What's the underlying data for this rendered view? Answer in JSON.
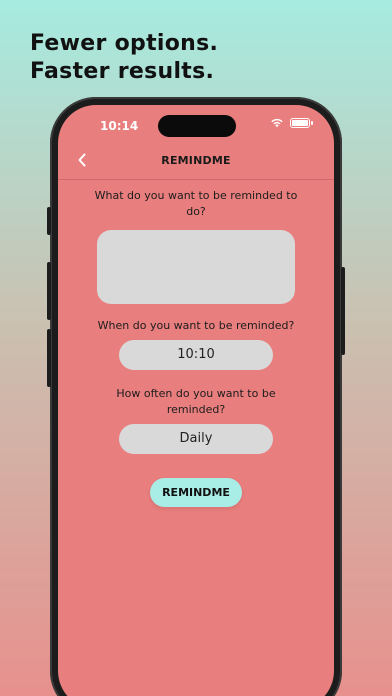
{
  "headline": {
    "line1": "Fewer options.",
    "line2": "Faster results."
  },
  "status_bar": {
    "time": "10:14",
    "icons": [
      "wifi-icon",
      "battery-icon"
    ]
  },
  "nav": {
    "title": "REMINDME",
    "back_icon": "chevron-left-icon"
  },
  "form": {
    "question_what": "What do you want to be reminded to do?",
    "reminder_text": "",
    "question_when": "When do you want to be reminded?",
    "time_value": "10:10",
    "question_frequency": "How often do you want to be reminded?",
    "frequency_value": "Daily",
    "submit_label": "REMINDME"
  },
  "colors": {
    "screen_bg": "#e87e7d",
    "field_bg": "#d9d9d9",
    "button_bg": "#a8ede6",
    "bg_top": "#a6ebe0",
    "bg_bottom": "#e7908d"
  }
}
